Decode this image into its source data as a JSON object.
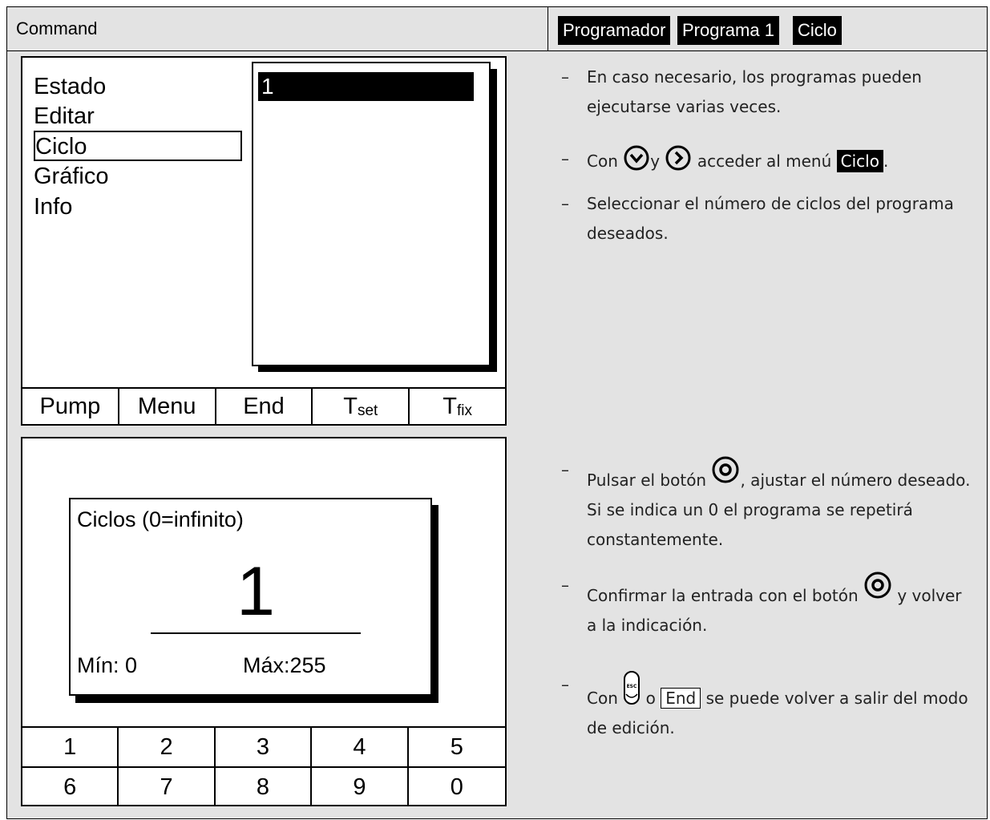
{
  "header": {
    "left_title": "Command",
    "breadcrumb": [
      "Programador",
      "Programa 1",
      "Ciclo"
    ]
  },
  "screen1": {
    "menu_items": [
      "Estado",
      "Editar",
      "Ciclo",
      "Gráfico",
      "Info"
    ],
    "selected_value": "1",
    "function_keys": {
      "pump": "Pump",
      "menu": "Menu",
      "end": "End",
      "tset_main": "T",
      "tset_sub": "set",
      "tfix_main": "T",
      "tfix_sub": "fix"
    }
  },
  "screen2": {
    "dialog_title": "Ciclos (0=infinito)",
    "value": "1",
    "min_label": "Mín: 0",
    "max_label": "Máx:255",
    "numpad": [
      "1",
      "2",
      "3",
      "4",
      "5",
      "6",
      "7",
      "8",
      "9",
      "0"
    ]
  },
  "instructions1": {
    "i1_line1": "En caso necesario, los programas pueden",
    "i1_line2": "ejecutarse varias veces.",
    "i2_pre": "Con",
    "i2_mid": "y",
    "i2_post": "acceder al menú",
    "i2_badge": "Ciclo",
    "i2_end": ".",
    "i3_line1": "Seleccionar el número de ciclos del programa",
    "i3_line2": "deseados."
  },
  "instructions2": {
    "i4_pre": "Pulsar el botón",
    "i4_post": ", ajustar el número deseado.",
    "i4_line2": "Si se indica un 0 el programa se repetirá",
    "i4_line3": "constantemente.",
    "i5_pre": "Confirmar la entrada con el botón",
    "i5_post": "y volver",
    "i5_line2": "a la indicación.",
    "i6_pre": "Con",
    "i6_esc": "ESC",
    "i6_mid": "o",
    "i6_box": "End",
    "i6_post": "se puede volver a salir del modo",
    "i6_line2": "de edición."
  },
  "dash": "–"
}
